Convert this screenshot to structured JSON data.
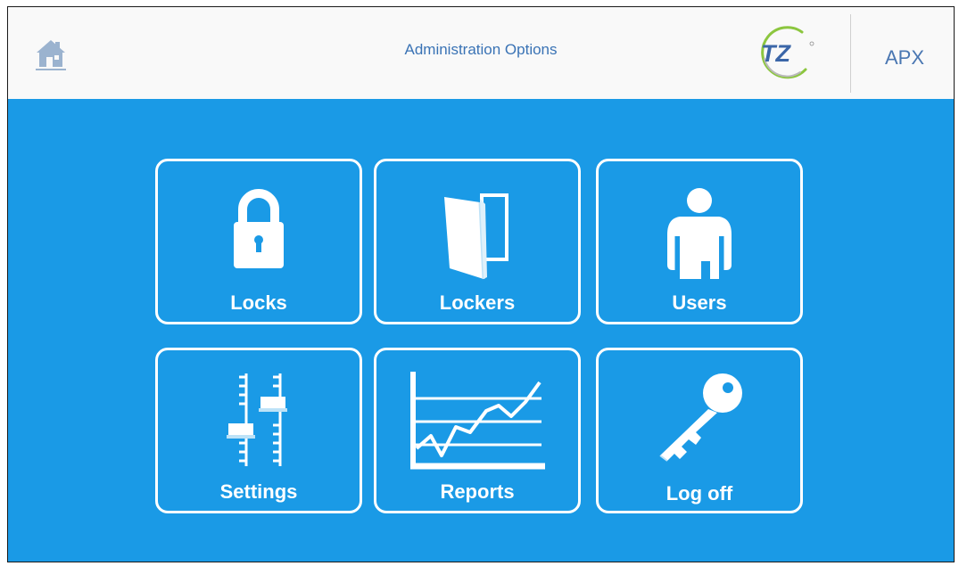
{
  "header": {
    "title": "Administration Options",
    "logo_text": "TZ",
    "product_name": "APX"
  },
  "tiles": [
    {
      "label": "Locks",
      "icon": "padlock-icon"
    },
    {
      "label": "Lockers",
      "icon": "locker-icon"
    },
    {
      "label": "Users",
      "icon": "user-icon"
    },
    {
      "label": "Settings",
      "icon": "sliders-icon"
    },
    {
      "label": "Reports",
      "icon": "line-chart-icon"
    },
    {
      "label": "Log off",
      "icon": "key-icon"
    }
  ],
  "colors": {
    "background": "#1a9ae6",
    "header": "#f9f9f9",
    "title_text": "#3a73b5",
    "tile_border": "#ffffff",
    "logo_green": "#8cc63f"
  }
}
